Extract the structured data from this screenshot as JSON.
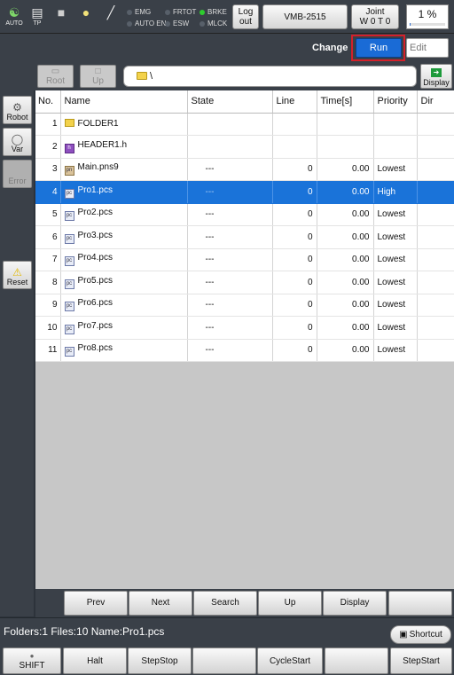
{
  "status": {
    "auto_label": "AUTO",
    "tp_label": "TP",
    "indicators": [
      {
        "label": "EMG",
        "on": false
      },
      {
        "label": "AUTO EN",
        "on": false
      },
      {
        "label": "FRTOT",
        "on": false
      },
      {
        "label": "ESW",
        "on": false
      },
      {
        "label": "BRKE",
        "on": true
      },
      {
        "label": "MLCK",
        "on": false
      }
    ],
    "logout_line1": "Log",
    "logout_line2": "out",
    "robot_model": "VMB-2515",
    "joint_line1": "Joint",
    "joint_line2": "W 0 T 0",
    "speed": "1 %",
    "speed_fraction": 0.01
  },
  "mode": {
    "change_label": "Change",
    "run_label": "Run",
    "edit_label": "Edit"
  },
  "left": {
    "robot_label": "Robot",
    "var_label": "Var",
    "error_label": "Error",
    "reset_label": "Reset"
  },
  "path": {
    "root_label": "Root",
    "up_label": "Up",
    "current": "\\",
    "display_label": "Display"
  },
  "table": {
    "headers": {
      "no": "No.",
      "name": "Name",
      "state": "State",
      "line": "Line",
      "time": "Time[s]",
      "priority": "Priority",
      "dir": "Dir"
    },
    "rows": [
      {
        "no": "1",
        "name": "FOLDER1",
        "state": "",
        "line": "",
        "time": "",
        "priority": "",
        "icon": "folder"
      },
      {
        "no": "2",
        "name": "HEADER1.h",
        "state": "",
        "line": "",
        "time": "",
        "priority": "",
        "icon": "header"
      },
      {
        "no": "3",
        "name": "Main.pns9",
        "state": "---",
        "line": "0",
        "time": "0.00",
        "priority": "Lowest",
        "icon": "pns"
      },
      {
        "no": "4",
        "name": "Pro1.pcs",
        "state": "---",
        "line": "0",
        "time": "0.00",
        "priority": "High",
        "icon": "pcs"
      },
      {
        "no": "5",
        "name": "Pro2.pcs",
        "state": "---",
        "line": "0",
        "time": "0.00",
        "priority": "Lowest",
        "icon": "pcs"
      },
      {
        "no": "6",
        "name": "Pro3.pcs",
        "state": "---",
        "line": "0",
        "time": "0.00",
        "priority": "Lowest",
        "icon": "pcs"
      },
      {
        "no": "7",
        "name": "Pro4.pcs",
        "state": "---",
        "line": "0",
        "time": "0.00",
        "priority": "Lowest",
        "icon": "pcs"
      },
      {
        "no": "8",
        "name": "Pro5.pcs",
        "state": "---",
        "line": "0",
        "time": "0.00",
        "priority": "Lowest",
        "icon": "pcs"
      },
      {
        "no": "9",
        "name": "Pro6.pcs",
        "state": "---",
        "line": "0",
        "time": "0.00",
        "priority": "Lowest",
        "icon": "pcs"
      },
      {
        "no": "10",
        "name": "Pro7.pcs",
        "state": "---",
        "line": "0",
        "time": "0.00",
        "priority": "Lowest",
        "icon": "pcs"
      },
      {
        "no": "11",
        "name": "Pro8.pcs",
        "state": "---",
        "line": "0",
        "time": "0.00",
        "priority": "Lowest",
        "icon": "pcs"
      }
    ],
    "selected_index": 3
  },
  "func": {
    "prev": "Prev",
    "next": "Next",
    "search": "Search",
    "up": "Up",
    "display": "Display",
    "empty": ""
  },
  "info": {
    "text": "Folders:1  Files:10  Name:Pro1.pcs",
    "shortcut_label": "Shortcut"
  },
  "cmd": {
    "shift": "SHIFT",
    "halt": "Halt",
    "stepstop": "StepStop",
    "empty1": "",
    "cyclestart": "CycleStart",
    "empty2": "",
    "stepstart": "StepStart"
  },
  "colors": {
    "selection": "#1a73d9",
    "run_mode": "#1a6bd6",
    "highlight_frame": "#d4202a",
    "brake_on": "#2ecc2e"
  }
}
